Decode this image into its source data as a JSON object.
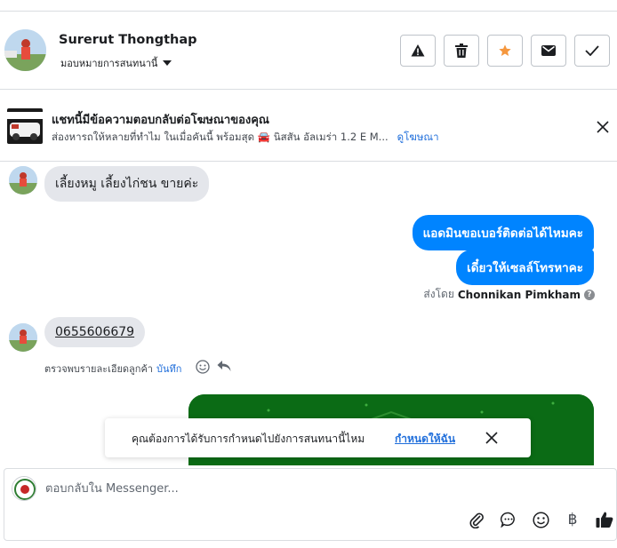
{
  "header": {
    "name": "Surerut Thongthap",
    "assign_label": "มอบหมายการสนทนานี้",
    "actions": [
      "warning-icon",
      "trash-icon",
      "star-icon",
      "envelope-icon",
      "check-icon"
    ],
    "star_color": "#f5973e"
  },
  "ad": {
    "title": "แชทนี้มีข้อความตอบกลับต่อโฆษณาของคุณ",
    "subtitle": "ส่องหารถให้หลายที่ทำไม ในเมื่อคันนี้ พร้อมสุด 🚘 นิสสัน อัลเมร่า 1.2 E M...",
    "link": "ดูโฆษณา"
  },
  "messages": {
    "in_1": "เลี้ยงหมู เลี้ยงไก่ชน ขายค่ะ",
    "out_1": "แอดมินขอเบอร์ติดต่อได้ไหมคะ",
    "out_2": "เดี๋ยวให้เซลล์โทรหาคะ",
    "sent_by_prefix": "ส่งโดย",
    "sent_by_name": "Chonnikan Pimkham",
    "in_2": "0655606679",
    "detect_text": "ตรวจพบรายละเอียดลูกค้า",
    "detect_save": "บันทึก"
  },
  "toast": {
    "text": "คุณต้องการได้รับการกำหนดไปยังการสนทนานี้ไหม",
    "link": "กำหนดให้ฉัน"
  },
  "composer": {
    "placeholder": "ตอบกลับใน Messenger...",
    "tools": [
      "paperclip-icon",
      "saved-reply-icon",
      "emoji-icon",
      "baht-icon",
      "thumbs-up-icon"
    ],
    "baht_symbol": "฿"
  },
  "colors": {
    "accent": "#0084ff",
    "link": "#216fdb",
    "incoming_bubble": "#e4e6eb",
    "border": "#dadde1"
  }
}
